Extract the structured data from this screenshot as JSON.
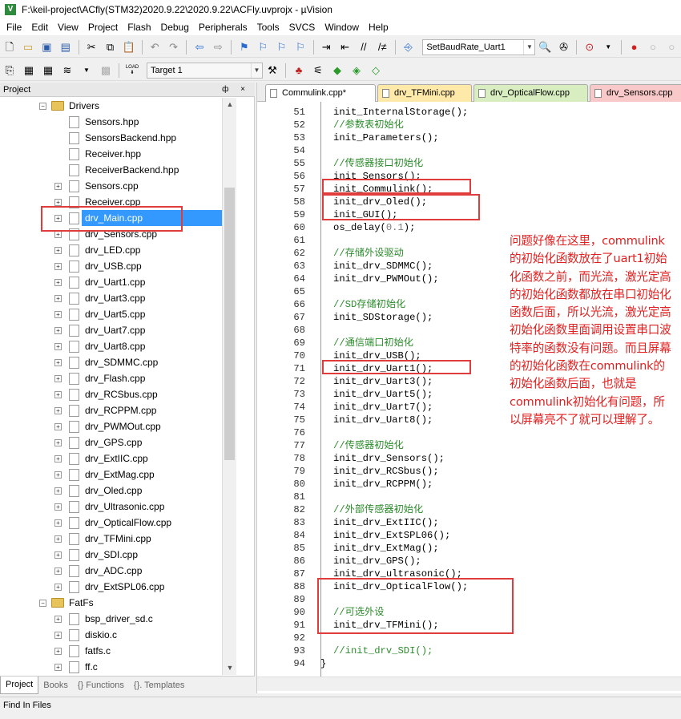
{
  "window": {
    "title": "F:\\keil-project\\ACfly(STM32)2020.9.22\\2020.9.22\\ACFly.uvprojx - µVision",
    "app_icon": "V"
  },
  "menu": [
    "File",
    "Edit",
    "View",
    "Project",
    "Flash",
    "Debug",
    "Peripherals",
    "Tools",
    "SVCS",
    "Window",
    "Help"
  ],
  "toolbar1": {
    "combo_value": "SetBaudRate_Uart1"
  },
  "toolbar2": {
    "load_label": "LOAD",
    "target": "Target 1"
  },
  "project_panel": {
    "title": "Project",
    "header_buttons": "ф ×",
    "tree": [
      {
        "label": "Drivers",
        "kind": "folder",
        "level": 1,
        "expanded": true
      },
      {
        "label": "Sensors.hpp",
        "kind": "file",
        "level": 2
      },
      {
        "label": "SensorsBackend.hpp",
        "kind": "file",
        "level": 2
      },
      {
        "label": "Receiver.hpp",
        "kind": "file",
        "level": 2
      },
      {
        "label": "ReceiverBackend.hpp",
        "kind": "file",
        "level": 2
      },
      {
        "label": "Sensors.cpp",
        "kind": "file",
        "level": 2,
        "expandable": true
      },
      {
        "label": "Receiver.cpp",
        "kind": "file",
        "level": 2,
        "expandable": true
      },
      {
        "label": "drv_Main.cpp",
        "kind": "file",
        "level": 2,
        "expandable": true,
        "selected": true
      },
      {
        "label": "drv_Sensors.cpp",
        "kind": "file",
        "level": 2,
        "expandable": true
      },
      {
        "label": "drv_LED.cpp",
        "kind": "file",
        "level": 2,
        "expandable": true
      },
      {
        "label": "drv_USB.cpp",
        "kind": "file",
        "level": 2,
        "expandable": true
      },
      {
        "label": "drv_Uart1.cpp",
        "kind": "file",
        "level": 2,
        "expandable": true
      },
      {
        "label": "drv_Uart3.cpp",
        "kind": "file",
        "level": 2,
        "expandable": true
      },
      {
        "label": "drv_Uart5.cpp",
        "kind": "file",
        "level": 2,
        "expandable": true
      },
      {
        "label": "drv_Uart7.cpp",
        "kind": "file",
        "level": 2,
        "expandable": true
      },
      {
        "label": "drv_Uart8.cpp",
        "kind": "file",
        "level": 2,
        "expandable": true
      },
      {
        "label": "drv_SDMMC.cpp",
        "kind": "file",
        "level": 2,
        "expandable": true
      },
      {
        "label": "drv_Flash.cpp",
        "kind": "file",
        "level": 2,
        "expandable": true
      },
      {
        "label": "drv_RCSbus.cpp",
        "kind": "file",
        "level": 2,
        "expandable": true
      },
      {
        "label": "drv_RCPPM.cpp",
        "kind": "file",
        "level": 2,
        "expandable": true
      },
      {
        "label": "drv_PWMOut.cpp",
        "kind": "file",
        "level": 2,
        "expandable": true
      },
      {
        "label": "drv_GPS.cpp",
        "kind": "file",
        "level": 2,
        "expandable": true
      },
      {
        "label": "drv_ExtIIC.cpp",
        "kind": "file",
        "level": 2,
        "expandable": true
      },
      {
        "label": "drv_ExtMag.cpp",
        "kind": "file",
        "level": 2,
        "expandable": true
      },
      {
        "label": "drv_Oled.cpp",
        "kind": "file",
        "level": 2,
        "expandable": true
      },
      {
        "label": "drv_Ultrasonic.cpp",
        "kind": "file",
        "level": 2,
        "expandable": true
      },
      {
        "label": "drv_OpticalFlow.cpp",
        "kind": "file",
        "level": 2,
        "expandable": true
      },
      {
        "label": "drv_TFMini.cpp",
        "kind": "file",
        "level": 2,
        "expandable": true
      },
      {
        "label": "drv_SDI.cpp",
        "kind": "file",
        "level": 2,
        "expandable": true
      },
      {
        "label": "drv_ADC.cpp",
        "kind": "file",
        "level": 2,
        "expandable": true
      },
      {
        "label": "drv_ExtSPL06.cpp",
        "kind": "file",
        "level": 2,
        "expandable": true
      },
      {
        "label": "FatFs",
        "kind": "folder",
        "level": 1,
        "expanded": true
      },
      {
        "label": "bsp_driver_sd.c",
        "kind": "file",
        "level": 2,
        "expandable": true
      },
      {
        "label": "diskio.c",
        "kind": "file",
        "level": 2,
        "expandable": true
      },
      {
        "label": "fatfs.c",
        "kind": "file",
        "level": 2,
        "expandable": true
      },
      {
        "label": "ff.c",
        "kind": "file",
        "level": 2,
        "expandable": true
      }
    ],
    "bottom_tabs": [
      "Project",
      "Books",
      "{} Functions",
      "{}. Templates"
    ]
  },
  "editor": {
    "tabs": [
      {
        "label": "Commulink.cpp*",
        "color": "#ffe9a8",
        "active": true
      },
      {
        "label": "drv_TFMini.cpp",
        "color": "#ffe9a8"
      },
      {
        "label": "drv_OpticalFlow.cpp",
        "color": "#d8eec0"
      },
      {
        "label": "drv_Sensors.cpp",
        "color": "#f9c9c9"
      }
    ],
    "lines": [
      {
        "n": "51",
        "text": "init_InternalStorage();",
        "kind": "code"
      },
      {
        "n": "52",
        "text": "//参数表初始化",
        "kind": "comment"
      },
      {
        "n": "53",
        "text": "init_Parameters();",
        "kind": "code"
      },
      {
        "n": "54",
        "text": "",
        "kind": "code"
      },
      {
        "n": "55",
        "text": "//传感器接口初始化",
        "kind": "comment"
      },
      {
        "n": "56",
        "text": "init_Sensors();",
        "kind": "code"
      },
      {
        "n": "57",
        "text": "init_Commulink();",
        "kind": "code"
      },
      {
        "n": "58",
        "text": "init_drv_Oled();",
        "kind": "code"
      },
      {
        "n": "59",
        "text": "init_GUI();",
        "kind": "code"
      },
      {
        "n": "60",
        "text": "os_delay(",
        "num": "0.1",
        "after": ");",
        "kind": "code"
      },
      {
        "n": "61",
        "text": "",
        "kind": "code"
      },
      {
        "n": "62",
        "text": "//存储外设驱动",
        "kind": "comment"
      },
      {
        "n": "63",
        "text": "init_drv_SDMMC();",
        "kind": "code"
      },
      {
        "n": "64",
        "text": "init_drv_PWMOut();",
        "kind": "code"
      },
      {
        "n": "65",
        "text": "",
        "kind": "code"
      },
      {
        "n": "66",
        "text": "//SD存储初始化",
        "kind": "comment"
      },
      {
        "n": "67",
        "text": "init_SDStorage();",
        "kind": "code"
      },
      {
        "n": "68",
        "text": "",
        "kind": "code"
      },
      {
        "n": "69",
        "text": "//通信端口初始化",
        "kind": "comment"
      },
      {
        "n": "70",
        "text": "init_drv_USB();",
        "kind": "code"
      },
      {
        "n": "71",
        "text": "init_drv_Uart1();",
        "kind": "code"
      },
      {
        "n": "72",
        "text": "init_drv_Uart3();",
        "kind": "code"
      },
      {
        "n": "73",
        "text": "init_drv_Uart5();",
        "kind": "code"
      },
      {
        "n": "74",
        "text": "init_drv_Uart7();",
        "kind": "code"
      },
      {
        "n": "75",
        "text": "init_drv_Uart8();",
        "kind": "code"
      },
      {
        "n": "76",
        "text": "",
        "kind": "code"
      },
      {
        "n": "77",
        "text": "//传感器初始化",
        "kind": "comment"
      },
      {
        "n": "78",
        "text": "init_drv_Sensors();",
        "kind": "code"
      },
      {
        "n": "79",
        "text": "init_drv_RCSbus();",
        "kind": "code"
      },
      {
        "n": "80",
        "text": "init_drv_RCPPM();",
        "kind": "code"
      },
      {
        "n": "81",
        "text": "",
        "kind": "code"
      },
      {
        "n": "82",
        "text": "//外部传感器初始化",
        "kind": "comment"
      },
      {
        "n": "83",
        "text": "init_drv_ExtIIC();",
        "kind": "code"
      },
      {
        "n": "84",
        "text": "init_drv_ExtSPL06();",
        "kind": "code"
      },
      {
        "n": "85",
        "text": "init_drv_ExtMag();",
        "kind": "code"
      },
      {
        "n": "86",
        "text": "init_drv_GPS();",
        "kind": "code"
      },
      {
        "n": "87",
        "text": "init_drv_ultrasonic();",
        "kind": "code"
      },
      {
        "n": "88",
        "text": "init_drv_OpticalFlow();",
        "kind": "code"
      },
      {
        "n": "89",
        "text": "",
        "kind": "code"
      },
      {
        "n": "90",
        "text": "//可选外设",
        "kind": "comment"
      },
      {
        "n": "91",
        "text": "init_drv_TFMini();",
        "kind": "code"
      },
      {
        "n": "92",
        "text": "",
        "kind": "code"
      },
      {
        "n": "93",
        "text": "//init_drv_SDI();",
        "kind": "comment"
      },
      {
        "n": "94",
        "text": "}",
        "kind": "brace"
      }
    ]
  },
  "annotation": "问题好像在这里，commulink的初始化函数放在了uart1初始化函数之前，而光流，激光定高的初始化函数都放在串口初始化函数后面，所以光流，激光定高初始化函数里面调用设置串口波特率的函数没有问题。而且屏幕的初始化函数在commulink的初始化函数后面，也就是commulink初始化有问题，所以屏幕亮不了就可以理解了。",
  "status_bar": "Find In Files",
  "colors": {
    "highlight": "#e03c3c",
    "selection": "#3399ff",
    "comment": "#2d8c2d"
  }
}
